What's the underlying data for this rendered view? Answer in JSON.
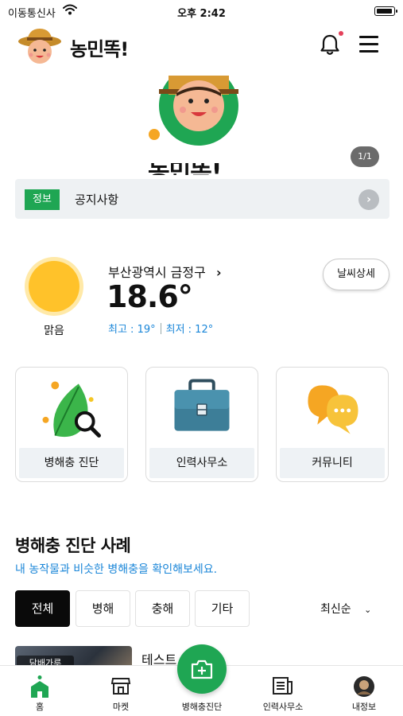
{
  "status_bar": {
    "carrier": "이동통신사",
    "time": "오후 2:42"
  },
  "header": {
    "title": "농민똑!"
  },
  "banner": {
    "title_fragment": "농민똑!",
    "page_indicator": "1/1"
  },
  "notice": {
    "tag": "정보",
    "text": "공지사항",
    "chevron": "›"
  },
  "weather": {
    "condition": "맑음",
    "location": "부산광역시 금정구",
    "location_chevron": "›",
    "temperature": "18.6°",
    "high": "최고 : 19°",
    "low": "최저 : 12°",
    "detail_button": "날씨상세",
    "colors": {
      "accent": "#1a86d8",
      "sun": "#ffc22a"
    }
  },
  "quick_menu": [
    {
      "label": "병해충 진단",
      "icon": "leaf-search-icon"
    },
    {
      "label": "인력사무소",
      "icon": "briefcase-icon"
    },
    {
      "label": "커뮤니티",
      "icon": "chat-bubbles-icon"
    }
  ],
  "cases": {
    "title": "병해충 진단 사례",
    "subtitle": "내 농작물과 비슷한 병해충을 확인해보세요.",
    "filters": [
      "전체",
      "병해",
      "충해",
      "기타"
    ],
    "active_filter": "전체",
    "sort": "최신순",
    "items": [
      {
        "title": "테스트",
        "tag": "담배가루"
      }
    ]
  },
  "tabbar": {
    "items": [
      {
        "label": "홈",
        "icon": "home-icon",
        "active": true
      },
      {
        "label": "마켓",
        "icon": "store-icon",
        "active": false
      },
      {
        "label": "병해충진단",
        "icon": "camera-plus-icon",
        "active": false
      },
      {
        "label": "인력사무소",
        "icon": "newspaper-icon",
        "active": false
      },
      {
        "label": "내정보",
        "icon": "profile-avatar-icon",
        "active": false
      }
    ],
    "colors": {
      "brand": "#1fa653"
    }
  }
}
